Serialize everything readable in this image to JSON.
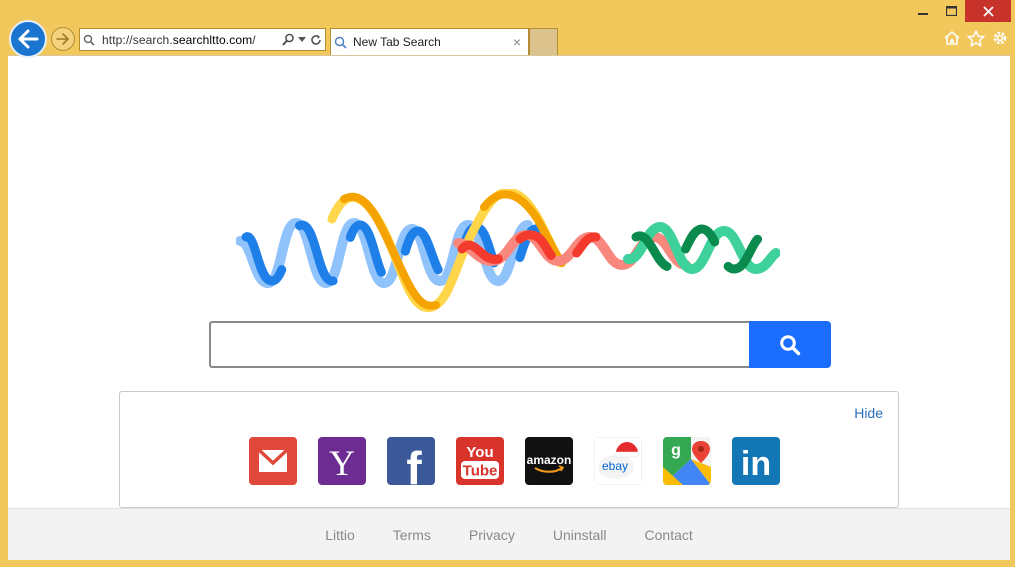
{
  "browser": {
    "address_prefix": "http://search.",
    "address_domain": "searchltto.com",
    "address_suffix": "/",
    "tab_title": "New Tab Search",
    "tab_close_glyph": "×",
    "icons": [
      "back-arrow-icon",
      "forward-arrow-icon",
      "magnifier-icon",
      "dropdown-arrow-icon",
      "refresh-icon",
      "home-icon",
      "star-icon",
      "gear-icon",
      "minimize-icon",
      "maximize-icon",
      "close-icon"
    ]
  },
  "page": {
    "search": {
      "placeholder": "",
      "value": ""
    },
    "shortcuts": {
      "hide_label": "Hide",
      "items": [
        {
          "name": "gmail",
          "icon": "gmail-envelope-icon",
          "color": "#e0483c"
        },
        {
          "name": "yahoo",
          "icon": "yahoo-y-icon",
          "color": "#6d2c92",
          "text": "Y"
        },
        {
          "name": "facebook",
          "icon": "facebook-f-icon",
          "color": "#3b5999",
          "text": "f"
        },
        {
          "name": "youtube",
          "icon": "youtube-icon",
          "color": "#d9342b",
          "text_top": "You",
          "text_bottom": "Tube"
        },
        {
          "name": "amazon",
          "icon": "amazon-icon",
          "color": "#111111",
          "text": "amazon"
        },
        {
          "name": "ebay",
          "icon": "ebay-santa-hat-icon",
          "color": "#ffffff",
          "text": "ebay"
        },
        {
          "name": "google-maps",
          "icon": "google-maps-icon",
          "color": "#34a853",
          "text": "g"
        },
        {
          "name": "linkedin",
          "icon": "linkedin-icon",
          "color": "#1377b5",
          "text": "in"
        }
      ]
    },
    "footer": {
      "links": [
        "Littio",
        "Terms",
        "Privacy",
        "Uninstall",
        "Contact"
      ]
    }
  },
  "colors": {
    "frame": "#f2c75c",
    "search_button": "#1a6dff",
    "close_button": "#c7322b",
    "link": "#2a6ebb"
  }
}
